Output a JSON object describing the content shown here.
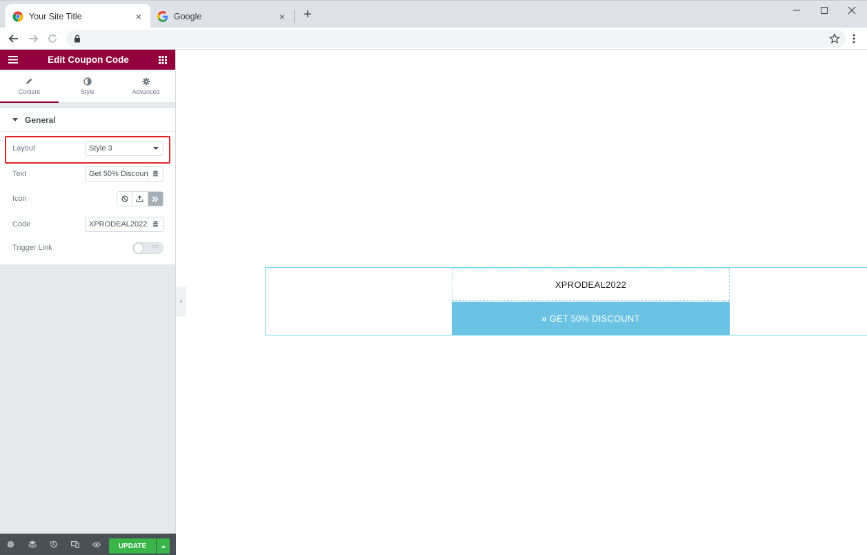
{
  "browser": {
    "tabs": [
      {
        "title": "Your Site Title",
        "close": "×"
      },
      {
        "title": "Google",
        "close": "×"
      }
    ],
    "new_tab": "+"
  },
  "panel": {
    "title": "Edit Coupon Code",
    "tabs": [
      {
        "label": "Content",
        "icon": "pencil-icon"
      },
      {
        "label": "Style",
        "icon": "contrast-icon"
      },
      {
        "label": "Advanced",
        "icon": "gear-icon"
      }
    ],
    "section_title": "General",
    "controls": {
      "layout": {
        "label": "Layout",
        "value": "Style 3"
      },
      "text": {
        "label": "Text",
        "value": "Get 50% Discount"
      },
      "icon": {
        "label": "Icon"
      },
      "code": {
        "label": "Code",
        "value": "XPRODEAL2022"
      },
      "trigger_link": {
        "label": "Trigger Link",
        "toggle_text": "NO"
      }
    },
    "footer": {
      "update_label": "UPDATE"
    },
    "collapse_glyph": "‹"
  },
  "canvas": {
    "coupon_code": "XPRODEAL2022",
    "button_label": "GET 50% DISCOUNT",
    "button_glyph": "»"
  },
  "colors": {
    "panel_header": "#93003c",
    "button_bg": "#6ac3e4",
    "update_green": "#39b54a",
    "highlight_red": "#e02424"
  }
}
